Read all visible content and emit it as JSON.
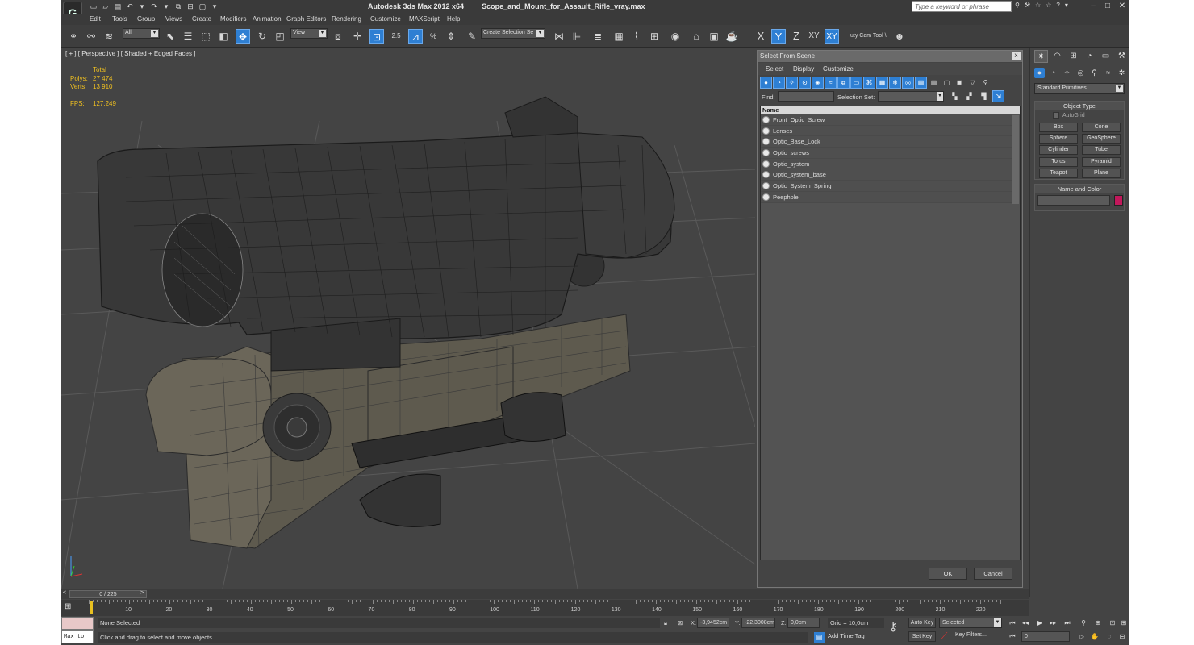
{
  "app": {
    "title": "Autodesk 3ds Max  2012 x64",
    "filename": "Scope_and_Mount_for_Assault_Rifle_vray.max",
    "search_placeholder": "Type a keyword or phrase"
  },
  "menu": [
    "Edit",
    "Tools",
    "Group",
    "Views",
    "Create",
    "Modifiers",
    "Animation",
    "Graph Editors",
    "Rendering",
    "Customize",
    "MAXScript",
    "Help"
  ],
  "toolbar": {
    "filter_value": "All",
    "ref_coord_value": "View",
    "snap_angle": "2.5",
    "named_selection": "Create Selection Se",
    "axes": [
      "X",
      "Y",
      "Z",
      "XY",
      "XY"
    ],
    "cam_tool": "uty Cam Tool \\"
  },
  "viewport": {
    "label": "[ + ] [ Perspective ] [ Shaded + Edged Faces ]",
    "stats_header": "Total",
    "stats": [
      {
        "key": "Polys:",
        "value": "27 474"
      },
      {
        "key": "Verts:",
        "value": "13 910"
      }
    ],
    "fps_key": "FPS:",
    "fps_value": "127,249"
  },
  "dialog": {
    "title": "Select From Scene",
    "close": "x",
    "menu": [
      "Select",
      "Display",
      "Customize"
    ],
    "find_label": "Find:",
    "selection_set_label": "Selection Set:",
    "list_header": "Name",
    "objects": [
      "Front_Optic_Screw",
      "Lenses",
      "Optic_Base_Lock",
      "Optic_screws",
      "Optic_system",
      "Optic_system_base",
      "Optic_System_Spring",
      "Peephole"
    ],
    "ok": "OK",
    "cancel": "Cancel"
  },
  "command_panel": {
    "dropdown": "Standard Primitives",
    "object_type_header": "Object Type",
    "autogrid": "AutoGrid",
    "buttons": [
      "Box",
      "Cone",
      "Sphere",
      "GeoSphere",
      "Cylinder",
      "Tube",
      "Torus",
      "Pyramid",
      "Teapot",
      "Plane"
    ],
    "name_color_header": "Name and Color",
    "object_color": "#c2185b"
  },
  "timeline": {
    "slider": "0 / 225",
    "prev": "<",
    "next": ">",
    "ticks": [
      10,
      20,
      30,
      40,
      50,
      60,
      70,
      80,
      90,
      100,
      110,
      120,
      130,
      140,
      150,
      160,
      170,
      180,
      190,
      200,
      210,
      220
    ]
  },
  "status": {
    "maxscript": "Max to",
    "selection": "None Selected",
    "prompt": "Click and drag to select and move objects",
    "x_label": "X:",
    "x_value": "-3,9452cm",
    "y_label": "Y:",
    "y_value": "-22,3008cm",
    "z_label": "Z:",
    "z_value": "0,0cm",
    "grid": "Grid = 10,0cm",
    "add_time_tag": "Add Time Tag",
    "auto_key": "Auto Key",
    "set_key": "Set Key",
    "key_mode": "Selected",
    "key_filters": "Key Filters...",
    "frame": "0"
  },
  "colors": {
    "accent": "#2e7fd3",
    "stats": "#f0c020",
    "viewport_bg": "#444444"
  }
}
